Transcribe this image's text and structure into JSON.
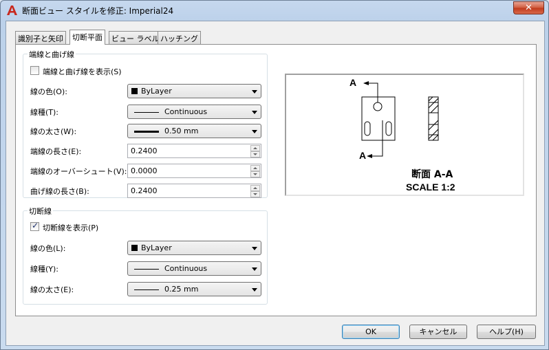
{
  "window": {
    "title": "断面ビュー スタイルを修正: Imperial24",
    "close_label": "✕"
  },
  "tabs": [
    {
      "label": "識別子と矢印"
    },
    {
      "label": "切断平面"
    },
    {
      "label": "ビュー ラベル"
    },
    {
      "label": "ハッチング"
    }
  ],
  "end_bend_group": {
    "title": "端線と曲げ線",
    "show_checkbox": {
      "label": "端線と曲げ線を表示(S)",
      "checked": false
    },
    "color": {
      "label": "線の色(O):",
      "value": "ByLayer"
    },
    "linetype": {
      "label": "線種(T):",
      "value": "Continuous"
    },
    "lineweight": {
      "label": "線の太さ(W):",
      "value": "0.50 mm"
    },
    "end_length": {
      "label": "端線の長さ(E):",
      "value": "0.2400"
    },
    "end_overshoot": {
      "label": "端線のオーバーシュート(V):",
      "value": "0.0000"
    },
    "bend_length": {
      "label": "曲げ線の長さ(B):",
      "value": "0.2400"
    }
  },
  "cutting_group": {
    "title": "切断線",
    "show_checkbox": {
      "label": "切断線を表示(P)",
      "checked": true
    },
    "color": {
      "label": "線の色(L):",
      "value": "ByLayer"
    },
    "linetype": {
      "label": "線種(Y):",
      "value": "Continuous"
    },
    "lineweight": {
      "label": "線の太さ(E):",
      "value": "0.25 mm"
    }
  },
  "preview": {
    "arrow_label_top": "A",
    "arrow_label_bottom": "A",
    "section_title": "断面 A-A",
    "scale_text": "SCALE 1:2"
  },
  "buttons": {
    "ok": "OK",
    "cancel": "キャンセル",
    "help": "ヘルプ(H)"
  },
  "colors": {
    "accent_red": "#c8281e",
    "active_tab_bg": "#ffffff"
  }
}
